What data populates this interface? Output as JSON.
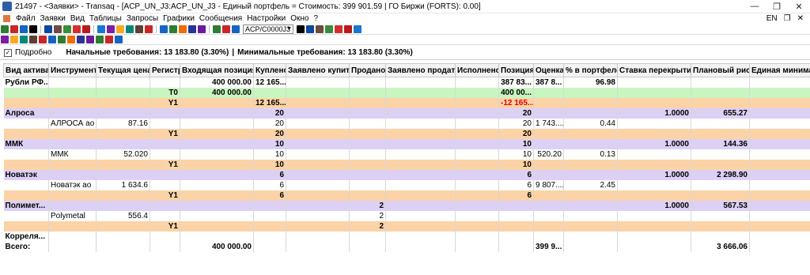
{
  "window": {
    "title": "21497 - <Заявки> - Transaq - [ACP_UN_J3:ACP_UN_J3 - Единый портфель = Стоимость: 399 901.59 | ГО Биржи (FORTS): 0.00]",
    "controls": [
      "—",
      "❐",
      "✕"
    ]
  },
  "menu": {
    "items": [
      "Файл",
      "Заявки",
      "Вид",
      "Таблицы",
      "Запросы",
      "Графики",
      "Сообщения",
      "Настройки",
      "Окно",
      "?"
    ],
    "lang": "EN",
    "restore": "❐",
    "close": "✕"
  },
  "toolbar": {
    "account_combo": "ACP/C0000J3",
    "colors": [
      "#2e7d32",
      "#c62828",
      "#1565c0",
      "#000000",
      "#0d47a1",
      "#6d4c41",
      "#388e3c",
      "#d32f2f",
      "#b71c1c",
      "#1976d2",
      "#7b1fa2",
      "#f9a825",
      "#00897b",
      "#5d4037",
      "#c62828",
      "#1565c0",
      "#2e7d32",
      "#ef6c00",
      "#283593",
      "#6a1b9a"
    ]
  },
  "filter": {
    "checkbox_checked": true,
    "detailed_label": "Подробно",
    "initial_req": "Начальные требования: 13 183.80 (3.30%)",
    "separator": "|",
    "min_req": "Минимальные требования: 13 183.80 (3.30%)"
  },
  "table": {
    "headers": [
      "Вид актива",
      "Инструмент",
      "Текущая цена",
      "Регистр",
      "Входящая позиция",
      "Куплено",
      "Заявлено купить",
      "Продано",
      "Заявлено продать",
      "Исполнено",
      "Позиция",
      "Оценка",
      "% в портфеле",
      "Ставка перекрытия",
      "Плановый риск",
      "Единая минимал"
    ],
    "rows": [
      {
        "style": "white bold",
        "cells": [
          "Рубли РФ...",
          "",
          "",
          "",
          "400 000.00",
          "12 165...",
          "",
          "",
          "",
          "",
          "387 83...",
          "387 8...",
          "96.98",
          "",
          "",
          ""
        ]
      },
      {
        "style": "green",
        "cells": [
          "",
          "",
          "",
          "T0",
          "400 000.00",
          "",
          "",
          "",
          "",
          "",
          "400 00...",
          "",
          "",
          "",
          "",
          ""
        ]
      },
      {
        "style": "orange",
        "red": 10,
        "cells": [
          "",
          "",
          "",
          "Y1",
          "",
          "12 165...",
          "",
          "",
          "",
          "",
          "-12 165...",
          "",
          "",
          "",
          "",
          ""
        ]
      },
      {
        "style": "purple",
        "cells": [
          "Алроса",
          "",
          "",
          "",
          "",
          "20",
          "",
          "",
          "",
          "",
          "20",
          "",
          "",
          "1.0000",
          "655.27",
          ""
        ]
      },
      {
        "style": "white",
        "cells": [
          "",
          "АЛРОСА ао",
          "87.16",
          "",
          "",
          "20",
          "",
          "",
          "",
          "",
          "20",
          "1 743....",
          "0.44",
          "",
          "",
          ""
        ]
      },
      {
        "style": "orange",
        "cells": [
          "",
          "",
          "",
          "Y1",
          "",
          "20",
          "",
          "",
          "",
          "",
          "20",
          "",
          "",
          "",
          "",
          ""
        ]
      },
      {
        "style": "purple",
        "cells": [
          "ММК",
          "",
          "",
          "",
          "",
          "10",
          "",
          "",
          "",
          "",
          "10",
          "",
          "",
          "1.0000",
          "144.36",
          ""
        ]
      },
      {
        "style": "white",
        "cells": [
          "",
          "ММК",
          "52.020",
          "",
          "",
          "10",
          "",
          "",
          "",
          "",
          "10",
          "520.20",
          "0.13",
          "",
          "",
          ""
        ]
      },
      {
        "style": "orange",
        "cells": [
          "",
          "",
          "",
          "Y1",
          "",
          "10",
          "",
          "",
          "",
          "",
          "10",
          "",
          "",
          "",
          "",
          ""
        ]
      },
      {
        "style": "purple",
        "cells": [
          "Новатэк",
          "",
          "",
          "",
          "",
          "6",
          "",
          "",
          "",
          "",
          "6",
          "",
          "",
          "1.0000",
          "2 298.90",
          ""
        ]
      },
      {
        "style": "white",
        "cells": [
          "",
          "Новатэк ао",
          "1 634.6",
          "",
          "",
          "6",
          "",
          "",
          "",
          "",
          "6",
          "9 807....",
          "2.45",
          "",
          "",
          ""
        ]
      },
      {
        "style": "orange",
        "cells": [
          "",
          "",
          "",
          "Y1",
          "",
          "6",
          "",
          "",
          "",
          "",
          "6",
          "",
          "",
          "",
          "",
          ""
        ]
      },
      {
        "style": "purple",
        "cells": [
          "Полимет...",
          "",
          "",
          "",
          "",
          "",
          "",
          "2",
          "",
          "",
          "",
          "",
          "",
          "1.0000",
          "567.53",
          ""
        ]
      },
      {
        "style": "white",
        "cells": [
          "",
          "Polymetal",
          "556.4",
          "",
          "",
          "",
          "",
          "2",
          "",
          "",
          "",
          "",
          "",
          "",
          "",
          ""
        ]
      },
      {
        "style": "orange",
        "cells": [
          "",
          "",
          "",
          "Y1",
          "",
          "",
          "",
          "2",
          "",
          "",
          "",
          "",
          "",
          "",
          "",
          ""
        ]
      },
      {
        "style": "white bold",
        "cells": [
          "Корреля...",
          "",
          "",
          "",
          "",
          "",
          "",
          "",
          "",
          "",
          "",
          "",
          "",
          "",
          "",
          ""
        ]
      },
      {
        "style": "white bold",
        "cells": [
          "Всего:",
          "",
          "",
          "",
          "400 000.00",
          "",
          "",
          "",
          "",
          "",
          "",
          "399 9...",
          "",
          "",
          "3 666.06",
          ""
        ]
      }
    ]
  }
}
